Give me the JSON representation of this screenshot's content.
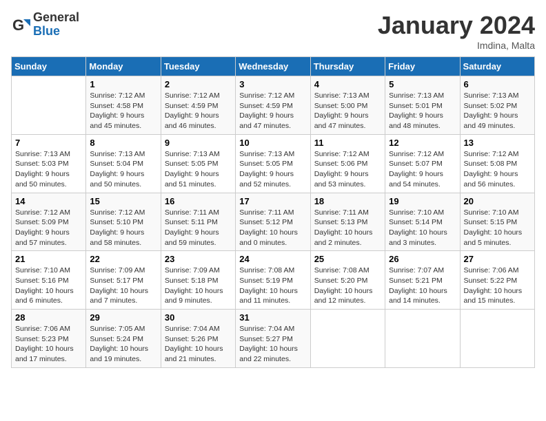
{
  "header": {
    "logo_general": "General",
    "logo_blue": "Blue",
    "month": "January 2024",
    "location": "Imdina, Malta"
  },
  "weekdays": [
    "Sunday",
    "Monday",
    "Tuesday",
    "Wednesday",
    "Thursday",
    "Friday",
    "Saturday"
  ],
  "weeks": [
    [
      {
        "day": "",
        "info": ""
      },
      {
        "day": "1",
        "info": "Sunrise: 7:12 AM\nSunset: 4:58 PM\nDaylight: 9 hours\nand 45 minutes."
      },
      {
        "day": "2",
        "info": "Sunrise: 7:12 AM\nSunset: 4:59 PM\nDaylight: 9 hours\nand 46 minutes."
      },
      {
        "day": "3",
        "info": "Sunrise: 7:12 AM\nSunset: 4:59 PM\nDaylight: 9 hours\nand 47 minutes."
      },
      {
        "day": "4",
        "info": "Sunrise: 7:13 AM\nSunset: 5:00 PM\nDaylight: 9 hours\nand 47 minutes."
      },
      {
        "day": "5",
        "info": "Sunrise: 7:13 AM\nSunset: 5:01 PM\nDaylight: 9 hours\nand 48 minutes."
      },
      {
        "day": "6",
        "info": "Sunrise: 7:13 AM\nSunset: 5:02 PM\nDaylight: 9 hours\nand 49 minutes."
      }
    ],
    [
      {
        "day": "7",
        "info": "Sunrise: 7:13 AM\nSunset: 5:03 PM\nDaylight: 9 hours\nand 50 minutes."
      },
      {
        "day": "8",
        "info": "Sunrise: 7:13 AM\nSunset: 5:04 PM\nDaylight: 9 hours\nand 50 minutes."
      },
      {
        "day": "9",
        "info": "Sunrise: 7:13 AM\nSunset: 5:05 PM\nDaylight: 9 hours\nand 51 minutes."
      },
      {
        "day": "10",
        "info": "Sunrise: 7:13 AM\nSunset: 5:05 PM\nDaylight: 9 hours\nand 52 minutes."
      },
      {
        "day": "11",
        "info": "Sunrise: 7:12 AM\nSunset: 5:06 PM\nDaylight: 9 hours\nand 53 minutes."
      },
      {
        "day": "12",
        "info": "Sunrise: 7:12 AM\nSunset: 5:07 PM\nDaylight: 9 hours\nand 54 minutes."
      },
      {
        "day": "13",
        "info": "Sunrise: 7:12 AM\nSunset: 5:08 PM\nDaylight: 9 hours\nand 56 minutes."
      }
    ],
    [
      {
        "day": "14",
        "info": "Sunrise: 7:12 AM\nSunset: 5:09 PM\nDaylight: 9 hours\nand 57 minutes."
      },
      {
        "day": "15",
        "info": "Sunrise: 7:12 AM\nSunset: 5:10 PM\nDaylight: 9 hours\nand 58 minutes."
      },
      {
        "day": "16",
        "info": "Sunrise: 7:11 AM\nSunset: 5:11 PM\nDaylight: 9 hours\nand 59 minutes."
      },
      {
        "day": "17",
        "info": "Sunrise: 7:11 AM\nSunset: 5:12 PM\nDaylight: 10 hours\nand 0 minutes."
      },
      {
        "day": "18",
        "info": "Sunrise: 7:11 AM\nSunset: 5:13 PM\nDaylight: 10 hours\nand 2 minutes."
      },
      {
        "day": "19",
        "info": "Sunrise: 7:10 AM\nSunset: 5:14 PM\nDaylight: 10 hours\nand 3 minutes."
      },
      {
        "day": "20",
        "info": "Sunrise: 7:10 AM\nSunset: 5:15 PM\nDaylight: 10 hours\nand 5 minutes."
      }
    ],
    [
      {
        "day": "21",
        "info": "Sunrise: 7:10 AM\nSunset: 5:16 PM\nDaylight: 10 hours\nand 6 minutes."
      },
      {
        "day": "22",
        "info": "Sunrise: 7:09 AM\nSunset: 5:17 PM\nDaylight: 10 hours\nand 7 minutes."
      },
      {
        "day": "23",
        "info": "Sunrise: 7:09 AM\nSunset: 5:18 PM\nDaylight: 10 hours\nand 9 minutes."
      },
      {
        "day": "24",
        "info": "Sunrise: 7:08 AM\nSunset: 5:19 PM\nDaylight: 10 hours\nand 11 minutes."
      },
      {
        "day": "25",
        "info": "Sunrise: 7:08 AM\nSunset: 5:20 PM\nDaylight: 10 hours\nand 12 minutes."
      },
      {
        "day": "26",
        "info": "Sunrise: 7:07 AM\nSunset: 5:21 PM\nDaylight: 10 hours\nand 14 minutes."
      },
      {
        "day": "27",
        "info": "Sunrise: 7:06 AM\nSunset: 5:22 PM\nDaylight: 10 hours\nand 15 minutes."
      }
    ],
    [
      {
        "day": "28",
        "info": "Sunrise: 7:06 AM\nSunset: 5:23 PM\nDaylight: 10 hours\nand 17 minutes."
      },
      {
        "day": "29",
        "info": "Sunrise: 7:05 AM\nSunset: 5:24 PM\nDaylight: 10 hours\nand 19 minutes."
      },
      {
        "day": "30",
        "info": "Sunrise: 7:04 AM\nSunset: 5:26 PM\nDaylight: 10 hours\nand 21 minutes."
      },
      {
        "day": "31",
        "info": "Sunrise: 7:04 AM\nSunset: 5:27 PM\nDaylight: 10 hours\nand 22 minutes."
      },
      {
        "day": "",
        "info": ""
      },
      {
        "day": "",
        "info": ""
      },
      {
        "day": "",
        "info": ""
      }
    ]
  ]
}
